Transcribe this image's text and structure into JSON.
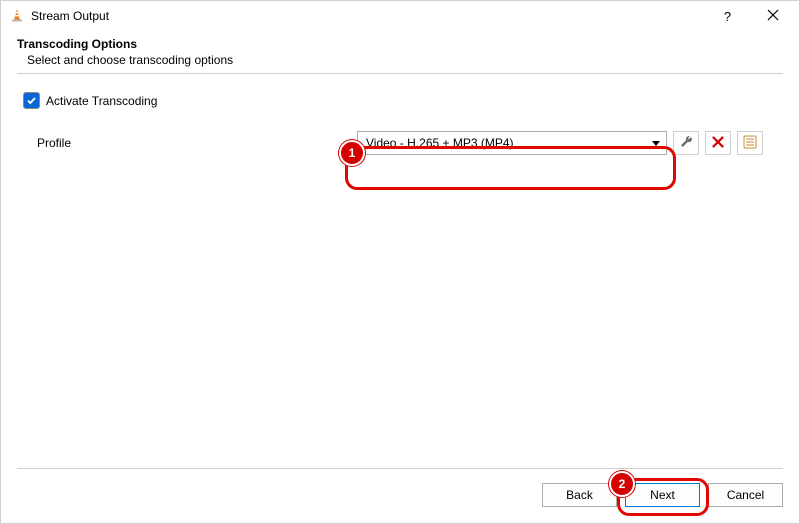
{
  "window": {
    "title": "Stream Output"
  },
  "section": {
    "title": "Transcoding Options",
    "subtitle": "Select and choose transcoding options"
  },
  "transcoding": {
    "activate_label": "Activate Transcoding",
    "profile_label": "Profile",
    "profile_value": "Video - H.265 + MP3 (MP4)"
  },
  "buttons": {
    "back": "Back",
    "next": "Next",
    "cancel": "Cancel"
  },
  "annotations": {
    "one": "1",
    "two": "2"
  }
}
